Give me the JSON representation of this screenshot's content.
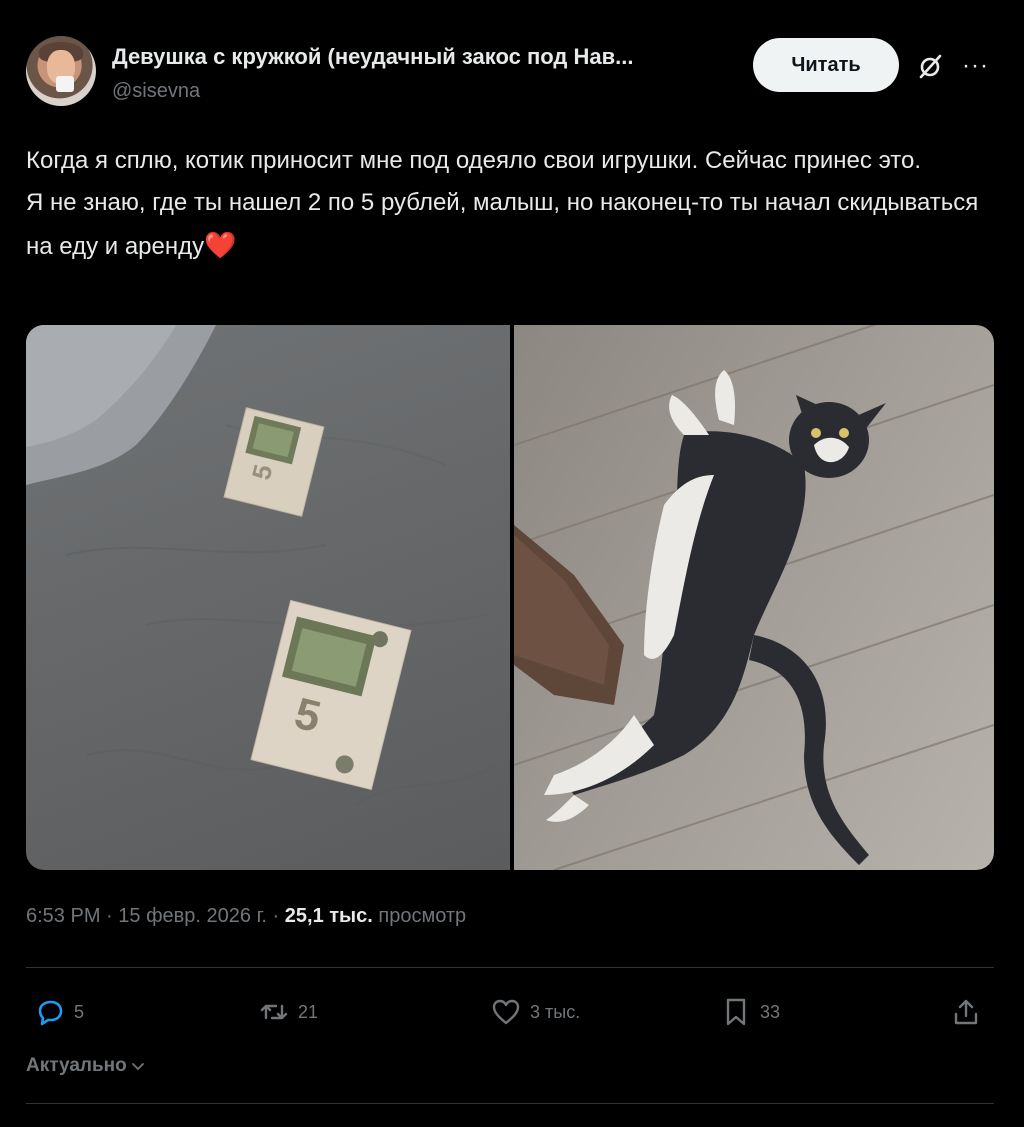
{
  "author": {
    "display_name": "Девушка с кружкой (неудачный закос под Нав...",
    "handle": "@sisevna"
  },
  "header": {
    "follow_label": "Читать"
  },
  "tweet": {
    "lines": [
      "Когда я сплю, котик приносит мне под одеяло свои игрушки. Сейчас принес это.",
      "Я не знаю, где ты нашел 2 по 5 рублей, малыш, но наконец-то ты начал скидываться на еду и аренду"
    ],
    "emoji": "❤️"
  },
  "banknotes": {
    "denomination": "5"
  },
  "meta": {
    "time": "6:53 PM",
    "separator": "·",
    "date": "15 февр. 2026 г.",
    "views_count": "25,1 тыс.",
    "views_label": "просмотр"
  },
  "actions": {
    "replies": "5",
    "reposts": "21",
    "likes": "3 тыс.",
    "bookmarks": "33"
  },
  "footer": {
    "sort_label": "Актуально"
  },
  "colors": {
    "background": "#000000",
    "text_primary": "#e7e9ea",
    "text_secondary": "#71767b",
    "divider": "#2f3336",
    "button_bg": "#eff3f4",
    "heart": "#f91880"
  }
}
